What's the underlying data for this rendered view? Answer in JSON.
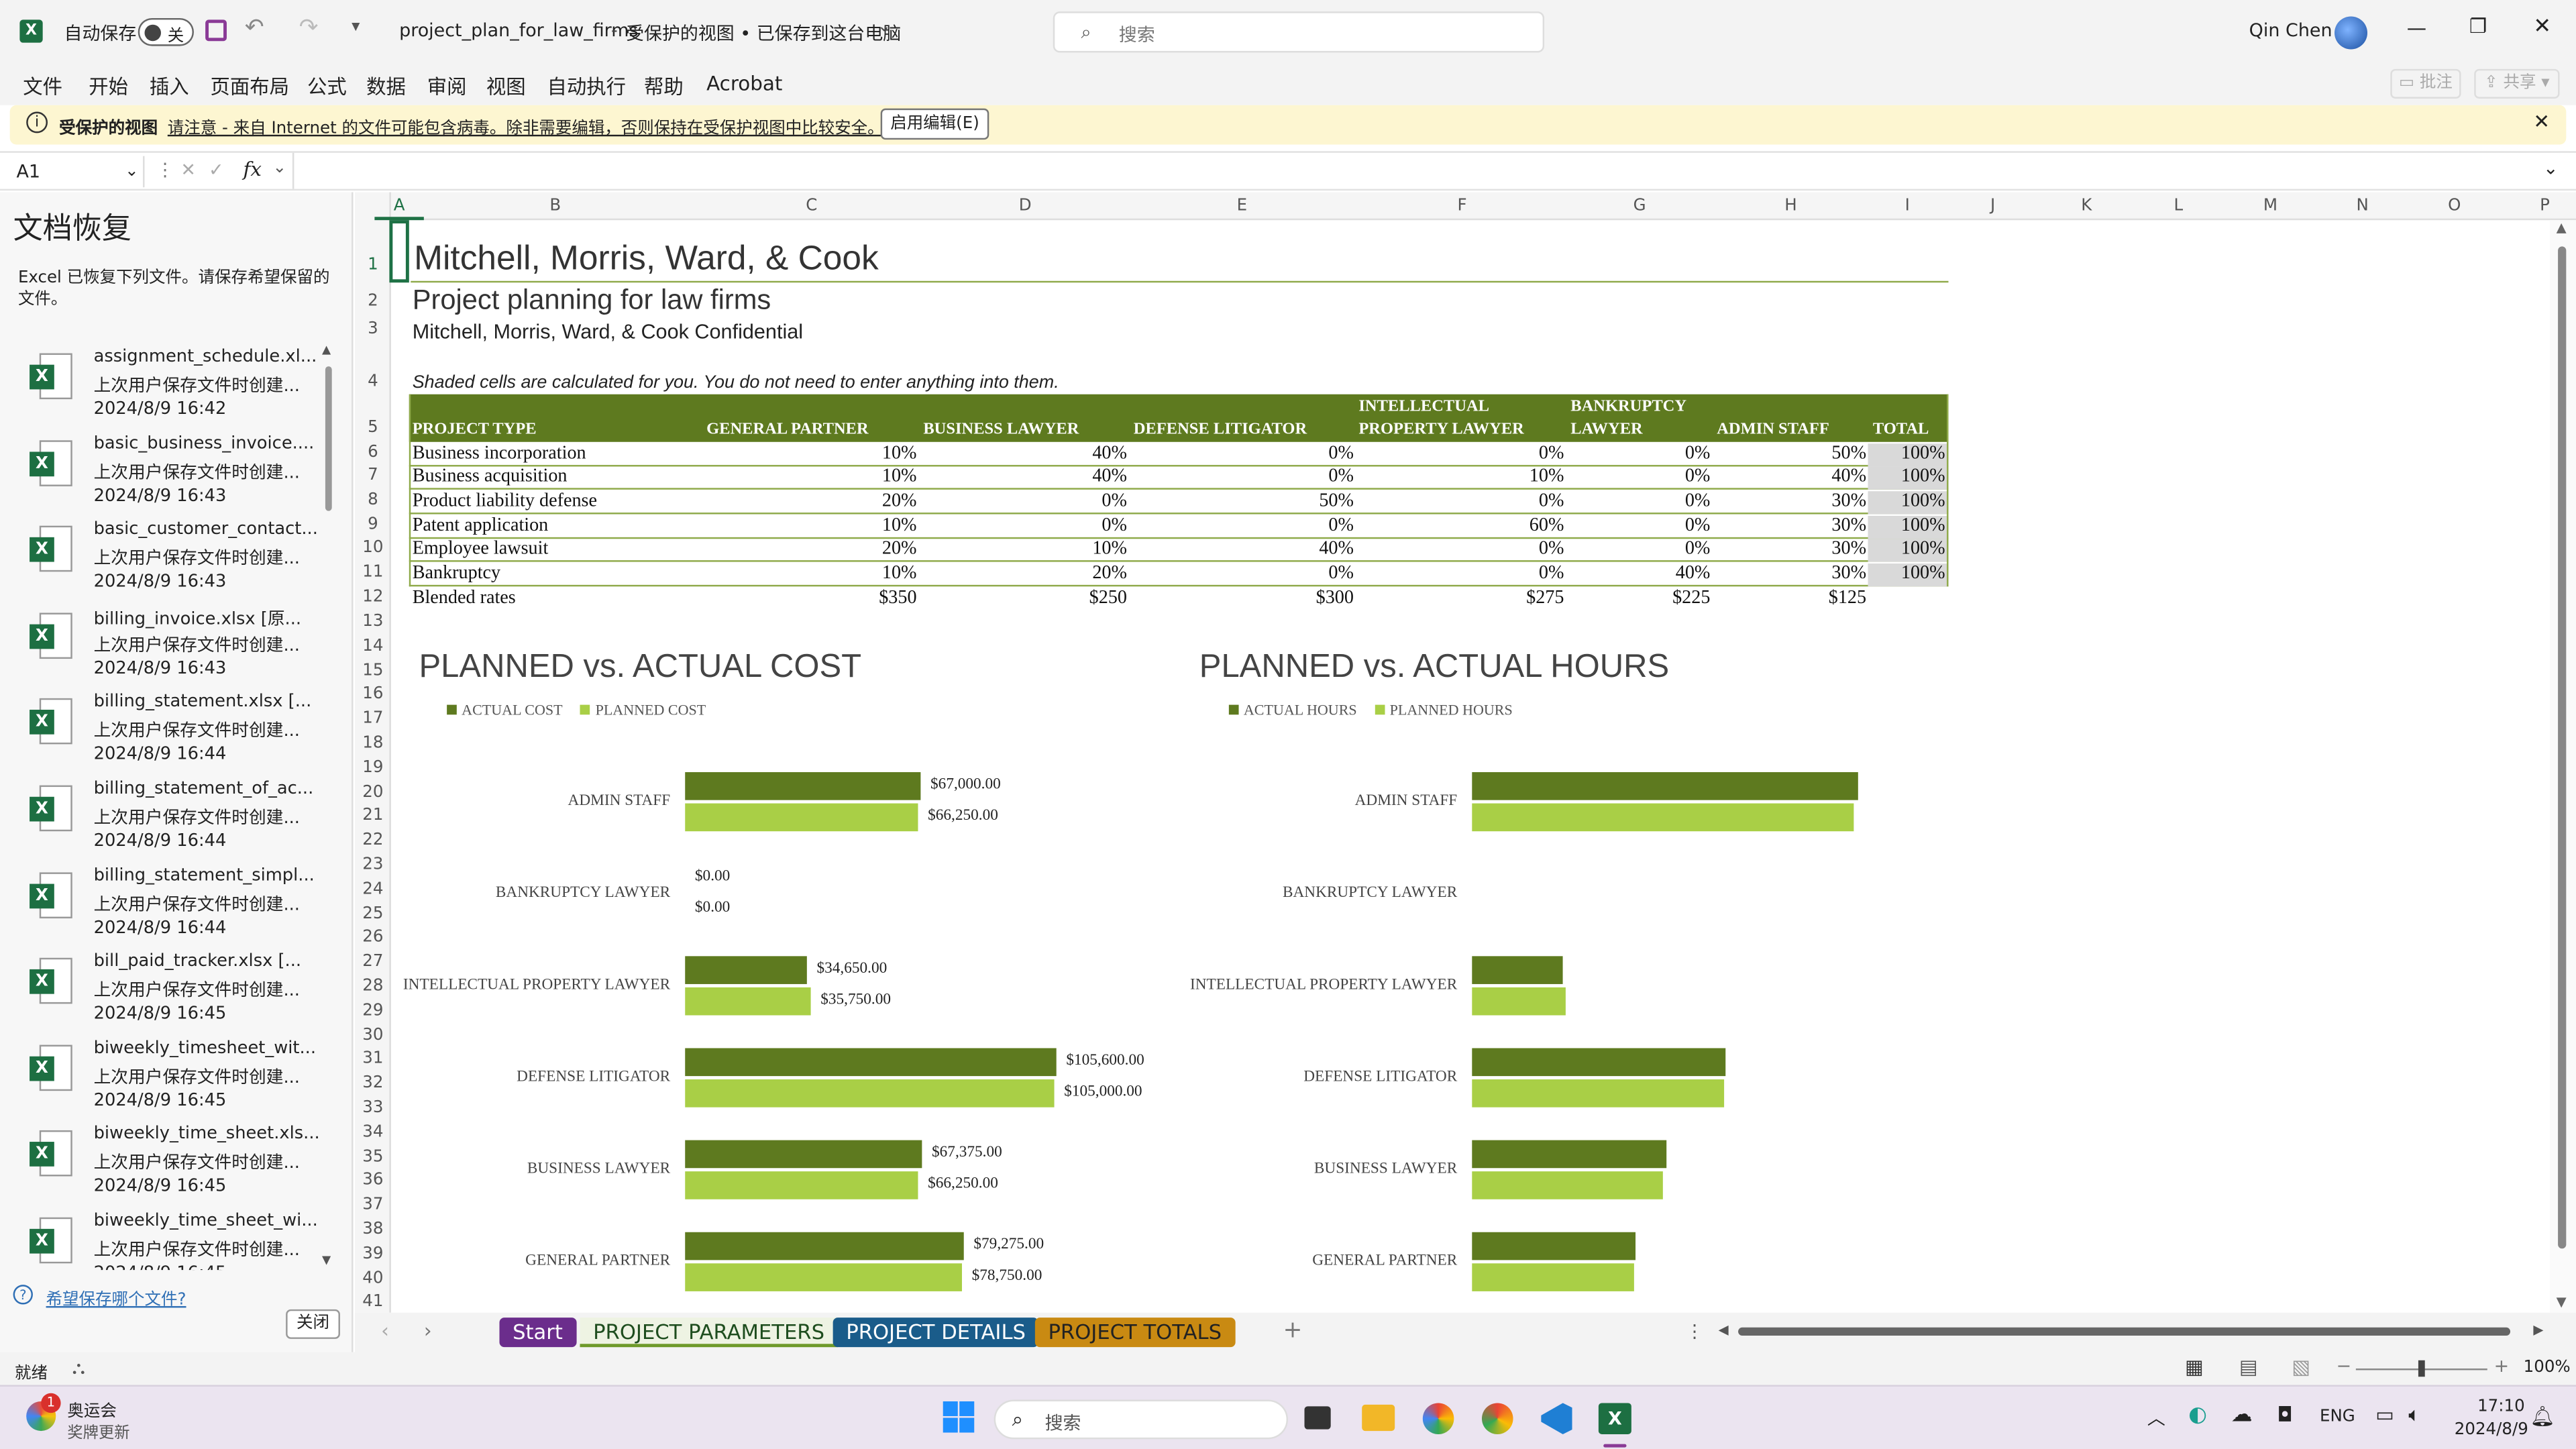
{
  "titlebar": {
    "autosave_label": "自动保存",
    "autosave_state": "关",
    "doc_title": "project_plan_for_law_firms",
    "doc_status": "受保护的视图 • 已保存到这台电脑",
    "search_placeholder": "搜索",
    "user_name": "Qin Chen"
  },
  "menu": [
    "文件",
    "开始",
    "插入",
    "页面布局",
    "公式",
    "数据",
    "审阅",
    "视图",
    "自动执行",
    "帮助",
    "Acrobat"
  ],
  "menu_right": {
    "comment": "批注",
    "share": "共享"
  },
  "protected": {
    "title": "受保护的视图",
    "message": "请注意 - 来自 Internet 的文件可能包含病毒。除非需要编辑，否则保持在受保护视图中比较安全。",
    "button": "启用编辑(E)"
  },
  "formula": {
    "name_box": "A1",
    "fx": "fx",
    "content": ""
  },
  "recovery": {
    "title": "文档恢复",
    "description": "Excel 已恢复下列文件。请保存希望保留的文件。",
    "files": [
      {
        "name": "assignment_schedule.xl...",
        "desc": "上次用户保存文件时创建...",
        "time": "2024/8/9 16:42"
      },
      {
        "name": "basic_business_invoice....",
        "desc": "上次用户保存文件时创建...",
        "time": "2024/8/9 16:43"
      },
      {
        "name": "basic_customer_contact...",
        "desc": "上次用户保存文件时创建...",
        "time": "2024/8/9 16:43"
      },
      {
        "name": "billing_invoice.xlsx  [原...",
        "desc": "上次用户保存文件时创建...",
        "time": "2024/8/9 16:43"
      },
      {
        "name": "billing_statement.xlsx  [...",
        "desc": "上次用户保存文件时创建...",
        "time": "2024/8/9 16:44"
      },
      {
        "name": "billing_statement_of_ac...",
        "desc": "上次用户保存文件时创建...",
        "time": "2024/8/9 16:44"
      },
      {
        "name": "billing_statement_simpl...",
        "desc": "上次用户保存文件时创建...",
        "time": "2024/8/9 16:44"
      },
      {
        "name": "bill_paid_tracker.xlsx  [...",
        "desc": "上次用户保存文件时创建...",
        "time": "2024/8/9 16:45"
      },
      {
        "name": "biweekly_timesheet_wit...",
        "desc": "上次用户保存文件时创建...",
        "time": "2024/8/9 16:45"
      },
      {
        "name": "biweekly_time_sheet.xls...",
        "desc": "上次用户保存文件时创建...",
        "time": "2024/8/9 16:45"
      },
      {
        "name": "biweekly_time_sheet_wi...",
        "desc": "上次用户保存文件时创建...",
        "time": "2024/8/9 16:45"
      }
    ],
    "help_link": "希望保存哪个文件?",
    "close_button": "关闭"
  },
  "columns": [
    "A",
    "B",
    "C",
    "D",
    "E",
    "F",
    "G",
    "H",
    "I",
    "J",
    "K",
    "L",
    "M",
    "N",
    "O",
    "P"
  ],
  "rows": [
    "1",
    "2",
    "3",
    "4",
    "5",
    "6",
    "7",
    "8",
    "9",
    "10",
    "11",
    "12",
    "13",
    "14",
    "15",
    "16",
    "17",
    "18",
    "19",
    "20",
    "21",
    "22",
    "23",
    "24",
    "25",
    "26",
    "27",
    "28",
    "29",
    "30",
    "31",
    "32",
    "33",
    "34",
    "35",
    "36",
    "37",
    "38",
    "39",
    "40",
    "41"
  ],
  "sheet": {
    "company": "Mitchell, Morris, Ward, & Cook",
    "subtitle": "Project planning for law firms",
    "confidential": "Mitchell, Morris, Ward, & Cook Confidential",
    "note": "Shaded cells are calculated for you. You do not need to enter anything into them.",
    "headers": [
      "PROJECT TYPE",
      "GENERAL PARTNER",
      "BUSINESS LAWYER",
      "DEFENSE LITIGATOR",
      "INTELLECTUAL PROPERTY LAWYER",
      "BANKRUPTCY LAWYER",
      "ADMIN STAFF",
      "TOTAL"
    ],
    "table": [
      [
        "Business incorporation",
        "10%",
        "40%",
        "0%",
        "0%",
        "0%",
        "50%",
        "100%"
      ],
      [
        "Business acquisition",
        "10%",
        "40%",
        "0%",
        "10%",
        "0%",
        "40%",
        "100%"
      ],
      [
        "Product liability defense",
        "20%",
        "0%",
        "50%",
        "0%",
        "0%",
        "30%",
        "100%"
      ],
      [
        "Patent application",
        "10%",
        "0%",
        "0%",
        "60%",
        "0%",
        "30%",
        "100%"
      ],
      [
        "Employee lawsuit",
        "20%",
        "10%",
        "40%",
        "0%",
        "0%",
        "30%",
        "100%"
      ],
      [
        "Bankruptcy",
        "10%",
        "20%",
        "0%",
        "0%",
        "40%",
        "30%",
        "100%"
      ]
    ],
    "blended": [
      "Blended rates",
      "$350",
      "$250",
      "$300",
      "$275",
      "$225",
      "$125"
    ]
  },
  "chart_data": [
    {
      "type": "bar",
      "title": "PLANNED vs. ACTUAL COST",
      "categories": [
        "ADMIN STAFF",
        "BANKRUPTCY LAWYER",
        "INTELLECTUAL PROPERTY LAWYER",
        "DEFENSE LITIGATOR",
        "BUSINESS LAWYER",
        "GENERAL PARTNER"
      ],
      "series": [
        {
          "name": "ACTUAL COST",
          "color": "#5e7a1f",
          "values": [
            67000,
            0,
            34650,
            105600,
            67375,
            79275
          ],
          "labels": [
            "$67,000.00",
            "$0.00",
            "$34,650.00",
            "$105,600.00",
            "$67,375.00",
            "$79,275.00"
          ]
        },
        {
          "name": "PLANNED COST",
          "color": "#a9cf46",
          "values": [
            66250,
            0,
            35750,
            105000,
            66250,
            78750
          ],
          "labels": [
            "$66,250.00",
            "$0.00",
            "$35,750.00",
            "$105,000.00",
            "$66,250.00",
            "$78,750.00"
          ]
        }
      ],
      "xlim": [
        0,
        120000
      ]
    },
    {
      "type": "bar",
      "title": "PLANNED vs. ACTUAL HOURS",
      "categories": [
        "ADMIN STAFF",
        "BANKRUPTCY LAWYER",
        "INTELLECTUAL PROPERTY LAWYER",
        "DEFENSE LITIGATOR",
        "BUSINESS LAWYER",
        "GENERAL PARTNER"
      ],
      "series": [
        {
          "name": "ACTUAL HOURS",
          "color": "#5e7a1f",
          "values": [
            536,
            0,
            126,
            352,
            270,
            227
          ]
        },
        {
          "name": "PLANNED HOURS",
          "color": "#a9cf46",
          "values": [
            530,
            0,
            130,
            350,
            265,
            225
          ]
        }
      ],
      "xlim": [
        0,
        600
      ]
    }
  ],
  "tabs": {
    "start": "Start",
    "params": "PROJECT PARAMETERS",
    "details": "PROJECT DETAILS",
    "totals": "PROJECT TOTALS",
    "add": "+"
  },
  "status": {
    "ready": "就绪",
    "zoom": "100%"
  },
  "taskbar": {
    "news_title": "奥运会",
    "news_sub": "奖牌更新",
    "search": "搜索",
    "lang": "ENG",
    "time": "17:10",
    "date": "2024/8/9",
    "badge": "1"
  }
}
